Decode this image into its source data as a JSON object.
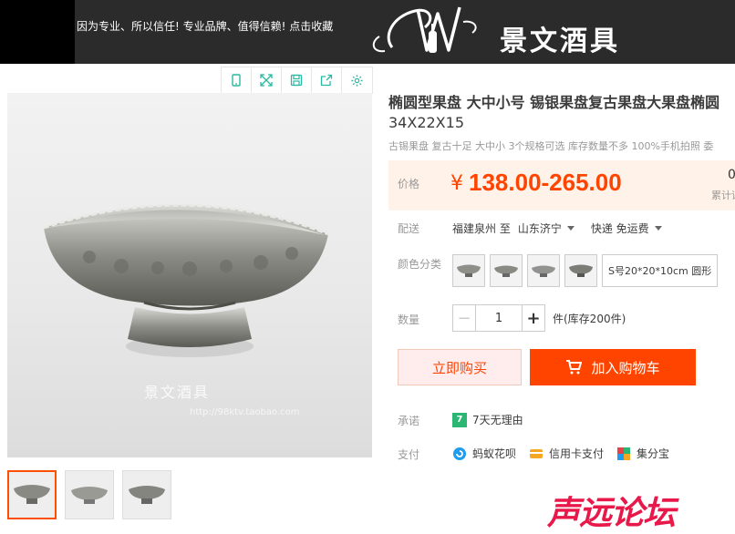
{
  "header": {
    "slogan": "因为专业、所以信任! 专业品牌、值得信赖! 点击收藏",
    "logo_text": "景文酒具"
  },
  "toolbar": {
    "icons": [
      "phone-icon",
      "expand-icon",
      "save-icon",
      "share-icon",
      "settings-icon"
    ]
  },
  "gallery": {
    "watermark": "景文酒具",
    "watermark_url": "http://98ktv.taobao.com"
  },
  "product": {
    "title_line1": "椭圆型果盘 大中小号 锡银果盘复古果盘大果盘椭圆",
    "title_line2": "34X22X15",
    "subtitle": "古锡果盘 复古十足 大中小 3个规格可选 库存数量不多 100%手机拍照 委",
    "price_label": "价格",
    "price_symbol": "¥",
    "price_value": "138.00-265.00",
    "sold_count": "0",
    "sold_label": "累计评",
    "shipping_label": "配送",
    "ship_from": "福建泉州 至",
    "ship_to": "山东济宁",
    "ship_method": "快递 免运费",
    "color_label": "颜色分类",
    "color_text_option": "S号20*20*10cm 圆形",
    "qty_label": "数量",
    "qty_minus": "−",
    "qty_value": "1",
    "qty_plus": "+",
    "stock": "件(库存200件)",
    "buy_now": "立即购买",
    "add_cart": "加入购物车",
    "promise_label": "承诺",
    "promise_badge": "7",
    "promise_text": "7天无理由",
    "pay_label": "支付",
    "pay_methods": [
      "蚂蚁花呗",
      "信用卡支付",
      "集分宝"
    ]
  },
  "overlay": {
    "forum_text": "声远论坛"
  },
  "colors": {
    "accent": "#ff4400",
    "price_bg": "#fff2e8",
    "header_bg": "#2b2b2b"
  }
}
